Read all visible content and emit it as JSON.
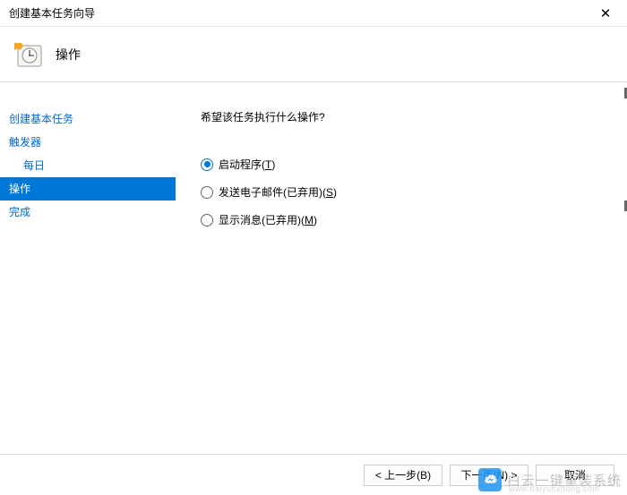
{
  "window": {
    "title": "创建基本任务向导"
  },
  "header": {
    "title": "操作"
  },
  "sidebar": {
    "items": [
      {
        "label": "创建基本任务",
        "indent": false,
        "active": false
      },
      {
        "label": "触发器",
        "indent": false,
        "active": false
      },
      {
        "label": "每日",
        "indent": true,
        "active": false
      },
      {
        "label": "操作",
        "indent": false,
        "active": true
      },
      {
        "label": "完成",
        "indent": false,
        "active": false
      }
    ]
  },
  "main": {
    "question": "希望该任务执行什么操作?",
    "options": [
      {
        "label": "启动程序",
        "accel": "T",
        "checked": true
      },
      {
        "label": "发送电子邮件(已弃用)",
        "accel": "S",
        "checked": false
      },
      {
        "label": "显示消息(已弃用)",
        "accel": "M",
        "checked": false
      }
    ]
  },
  "footer": {
    "back": "< 上一步(B)",
    "next": "下一页(N) >",
    "cancel": "取消"
  },
  "watermark": {
    "text": "白云一键重装系统",
    "sub": "www.baiyunxitong.com"
  }
}
